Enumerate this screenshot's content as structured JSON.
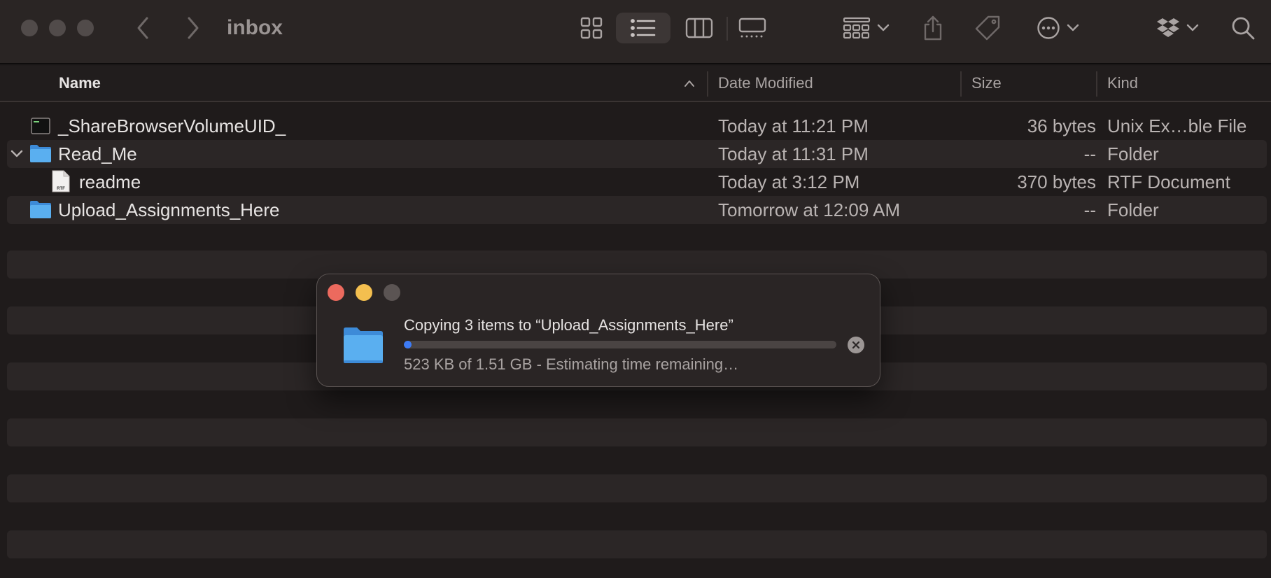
{
  "window": {
    "title": "inbox"
  },
  "columns": {
    "name": "Name",
    "date": "Date Modified",
    "size": "Size",
    "kind": "Kind"
  },
  "files": [
    {
      "name": "_ShareBrowserVolumeUID_",
      "date": "Today at 11:21 PM",
      "size": "36 bytes",
      "kind": "Unix Ex…ble File",
      "icon": "exec-file-icon"
    },
    {
      "name": "Read_Me",
      "date": "Today at 11:31 PM",
      "size": "--",
      "kind": "Folder",
      "icon": "folder-icon",
      "expanded": true
    },
    {
      "name": "readme",
      "date": "Today at 3:12 PM",
      "size": "370 bytes",
      "kind": "RTF Document",
      "icon": "rtf-document-icon"
    },
    {
      "name": "Upload_Assignments_Here",
      "date": "Tomorrow at 12:09 AM",
      "size": "--",
      "kind": "Folder",
      "icon": "folder-icon"
    }
  ],
  "rtf_badge": "RTF",
  "copy_dialog": {
    "title": "Copying 3 items to “Upload_Assignments_Here”",
    "status": "523 KB of 1.51 GB - Estimating time remaining…",
    "progress_fraction": 0.0003
  },
  "colors": {
    "close": "#ec6a5e",
    "minimize": "#f4bf4f",
    "accent": "#3d7bf5",
    "folder": "#5aaff0"
  }
}
